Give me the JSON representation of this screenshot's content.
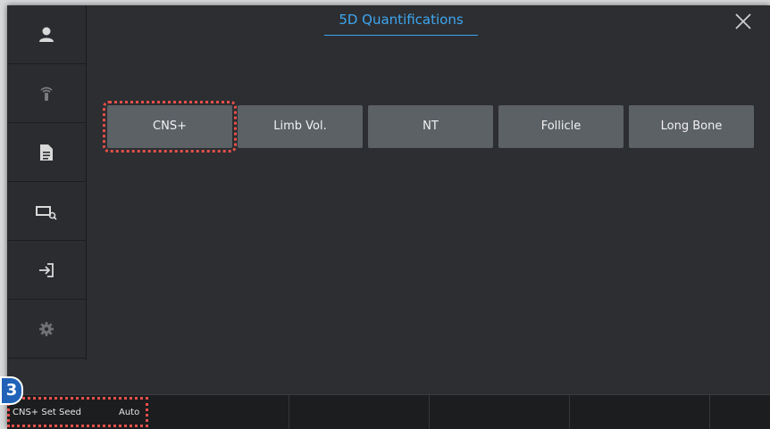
{
  "title": "5D Quantifications",
  "sidebar": {
    "items": [
      {
        "icon": "patient-icon"
      },
      {
        "icon": "probe-icon"
      },
      {
        "icon": "report-icon"
      },
      {
        "icon": "review-icon"
      },
      {
        "icon": "exit-icon"
      },
      {
        "icon": "settings-icon"
      }
    ]
  },
  "buttons": [
    {
      "label": "CNS+",
      "selected": true
    },
    {
      "label": "Limb Vol."
    },
    {
      "label": "NT"
    },
    {
      "label": "Follicle"
    },
    {
      "label": "Long Bone"
    }
  ],
  "bottom_bar": {
    "seed_label": "CNS+ Set Seed",
    "seed_value": "Auto"
  },
  "step_badge": "3",
  "colors": {
    "accent": "#3ea6f0",
    "highlight": "#e8504a",
    "button_bg": "#5c6166",
    "panel_bg": "#2c2e31"
  }
}
